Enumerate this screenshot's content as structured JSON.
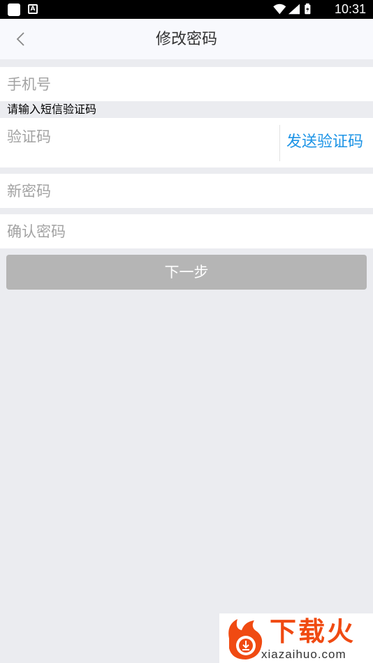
{
  "status_bar": {
    "time": "10:31",
    "app_badge": "A",
    "icons": [
      "notification-square-icon",
      "wifi-icon",
      "cell-signal-icon",
      "battery-icon"
    ]
  },
  "header": {
    "back_icon": "chevron-left-icon",
    "title": "修改密码"
  },
  "form": {
    "phone": {
      "value": "",
      "placeholder": "手机号"
    },
    "sms_hint": "请输入短信验证码",
    "code": {
      "value": "",
      "placeholder": "验证码"
    },
    "send_code_label": "发送验证码",
    "new_password": {
      "value": "",
      "placeholder": "新密码"
    },
    "confirm_password": {
      "value": "",
      "placeholder": "确认密码"
    },
    "next_label": "下一步"
  },
  "watermark": {
    "title": "下载火",
    "url": "xiazaihuo.com"
  },
  "colors": {
    "background": "#ebecf0",
    "header_bg": "#f8f9fd",
    "accent": "#1d94e6",
    "button_disabled": "#b5b5b5",
    "watermark_brand": "#f04a12"
  }
}
